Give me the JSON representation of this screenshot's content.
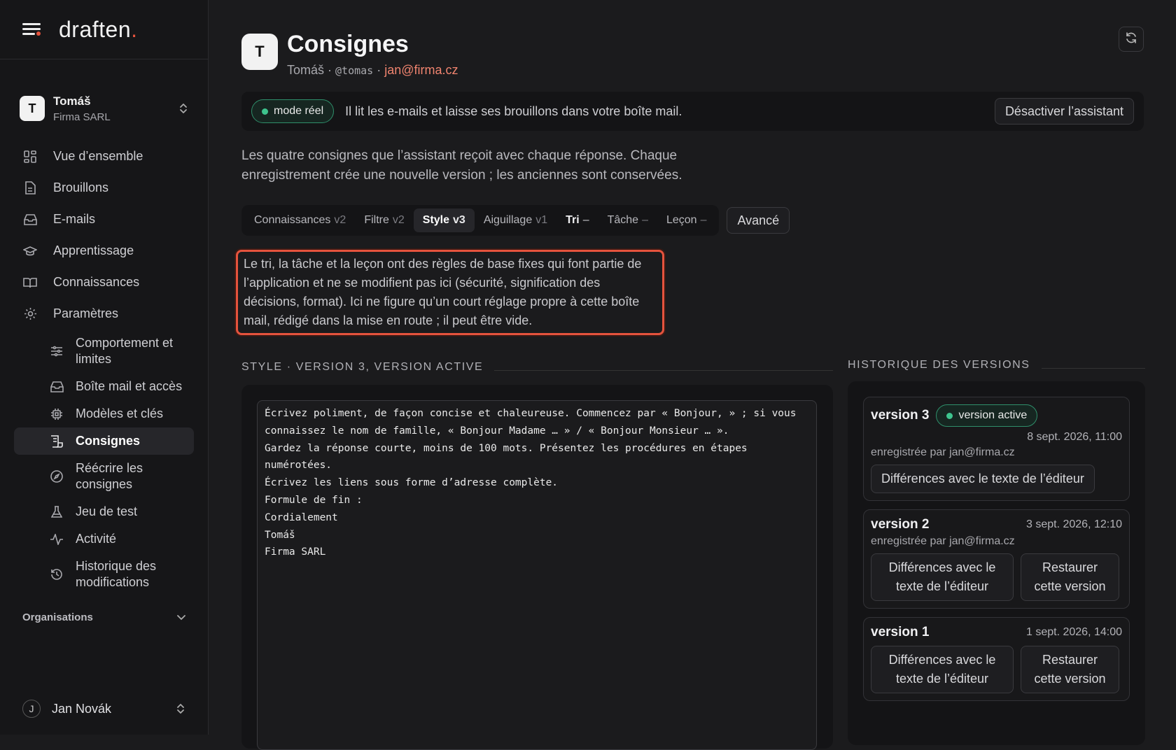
{
  "brand": {
    "logo_text": "draften",
    "logo_dot": "."
  },
  "workspace": {
    "initial": "T",
    "name": "Tomáš",
    "company": "Firma SARL"
  },
  "nav": {
    "overview": "Vue d’ensemble",
    "drafts": "Brouillons",
    "emails": "E-mails",
    "learning": "Apprentissage",
    "knowledge": "Connaissances",
    "settings": "Paramètres",
    "sub": {
      "behavior": "Comportement et limites",
      "mailbox": "Boîte mail et accès",
      "models": "Modèles et clés",
      "instructions": "Consignes",
      "rewrite": "Réécrire les consignes",
      "testset": "Jeu de test",
      "activity": "Activité",
      "history": "Historique des modifications"
    },
    "organisations": "Organisations"
  },
  "user": {
    "initial": "J",
    "name": "Jan Novák"
  },
  "header": {
    "initial": "T",
    "title": "Consignes",
    "name": "Tomáš",
    "sep": " · ",
    "handle": "@tomas",
    "email": "jan@firma.cz"
  },
  "banner": {
    "mode_label": "mode réel",
    "text": "Il lit les e-mails et laisse ses brouillons dans votre boîte mail.",
    "disable_label": "Désactiver l’assistant"
  },
  "description": "Les quatre consignes que l’assistant reçoit avec chaque réponse. Chaque enregistrement crée une nouvelle version ; les anciennes sont conservées.",
  "tabs": [
    {
      "label": "Connaissances",
      "version": "v2"
    },
    {
      "label": "Filtre",
      "version": "v2"
    },
    {
      "label": "Style",
      "version": "v3"
    },
    {
      "label": "Aiguillage",
      "version": "v1"
    },
    {
      "label": "Tri",
      "version": "–"
    },
    {
      "label": "Tâche",
      "version": "–"
    },
    {
      "label": "Leçon",
      "version": "–"
    }
  ],
  "advanced_label": "Avancé",
  "note": "Le tri, la tâche et la leçon ont des règles de base fixes qui font partie de l’application et ne se modifient pas ici (sécurité, signification des décisions, format). Ici ne figure qu’un court réglage propre à cette boîte mail, rédigé dans la mise en route ; il peut être vide.",
  "editor": {
    "heading": "STYLE · VERSION 3, VERSION ACTIVE",
    "content": "Écrivez poliment, de façon concise et chaleureuse. Commencez par « Bonjour, » ; si vous connaissez le nom de famille, « Bonjour Madame … » / « Bonjour Monsieur … ».\nGardez la réponse courte, moins de 100 mots. Présentez les procédures en étapes numérotées.\nÉcrivez les liens sous forme d’adresse complète.\nFormule de fin :\nCordialement\nTomáš\nFirma SARL"
  },
  "history": {
    "heading": "HISTORIQUE DES VERSIONS",
    "versions": [
      {
        "name": "version 3",
        "badge": "version active",
        "date": "8 sept. 2026, 11:00",
        "by": "enregistrée par jan@firma.cz",
        "diff_label": "Différences avec le texte de l’éditeur"
      },
      {
        "name": "version 2",
        "date": "3 sept. 2026, 12:10",
        "by": "enregistrée par jan@firma.cz",
        "diff_label": "Différences avec le texte de l’éditeur",
        "restore_label": "Restaurer cette version"
      },
      {
        "name": "version 1",
        "date": "1 sept. 2026, 14:00",
        "diff_label": "Différences avec le texte de l’éditeur",
        "restore_label": "Restaurer cette version"
      }
    ]
  },
  "colors": {
    "accent": "#e5533d",
    "active_green": "#3ec48e",
    "link": "#f0846f",
    "background": "#1b1b1d"
  }
}
